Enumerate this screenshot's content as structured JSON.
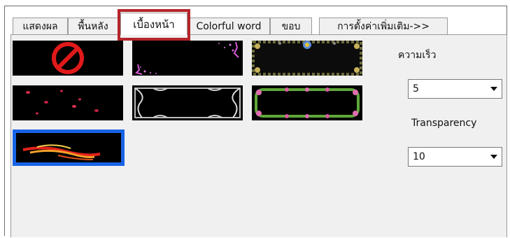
{
  "tabs": [
    {
      "label": "แสดงผล"
    },
    {
      "label": "พื้นหลัง"
    },
    {
      "label": "เบื้องหน้า"
    },
    {
      "label": "Colorful word"
    },
    {
      "label": "ขอบ"
    },
    {
      "label": "การตั้งค่าเพิ่มเติม->>"
    }
  ],
  "active_tab": "เบื้องหน้า",
  "settings": {
    "speed_label": "ความเร็ว",
    "speed_value": "5",
    "transparency_label": "Transparency",
    "transparency_value": "10"
  },
  "thumbnails": [
    {
      "icon": "prohibited-sign-effect"
    },
    {
      "icon": "pink-sparkle-effect"
    },
    {
      "icon": "flower-frame-effect"
    },
    {
      "icon": "red-petals-effect"
    },
    {
      "icon": "silver-ornament-frame-effect"
    },
    {
      "icon": "pink-flower-frame-effect"
    },
    {
      "icon": "fire-streak-effect",
      "selected": true
    }
  ],
  "colors": {
    "highlight": "#b5252a",
    "selection": "#1863e6",
    "panel_bg": "#f0f0f0"
  }
}
